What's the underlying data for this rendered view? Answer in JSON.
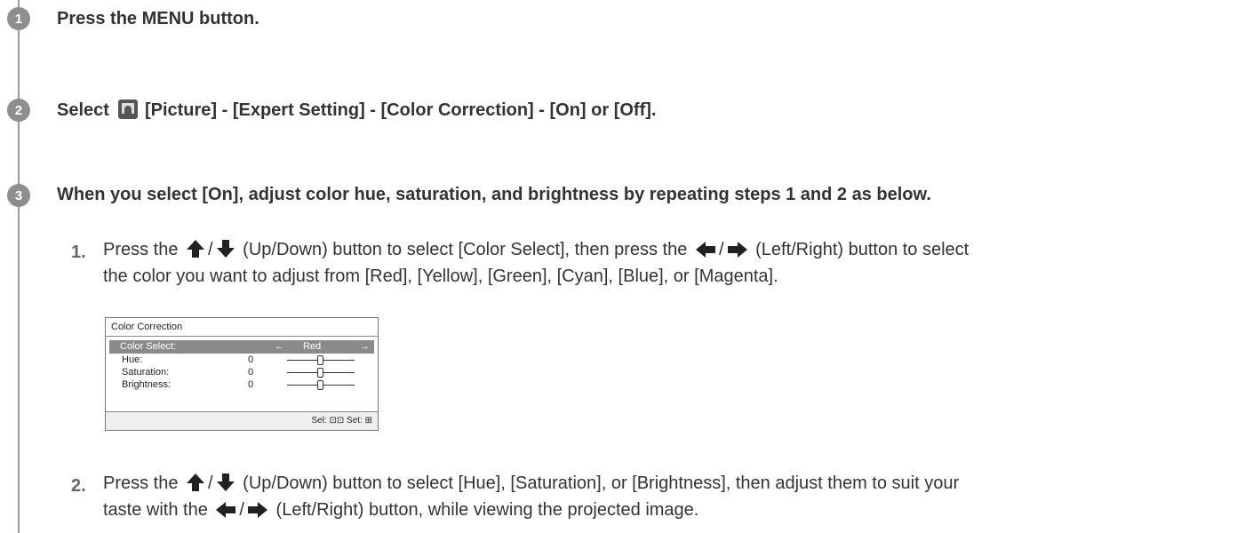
{
  "steps": [
    {
      "number": "1",
      "text": "Press the MENU button."
    },
    {
      "number": "2",
      "prefix": "Select",
      "text": "[Picture] - [Expert Setting] - [Color Correction] - [On] or [Off]."
    },
    {
      "number": "3",
      "text": "When you select [On], adjust color hue, saturation, and brightness by repeating steps 1 and 2 as below."
    }
  ],
  "substeps": [
    {
      "number": "1.",
      "line1_a": "Press the",
      "line1_b": "(Up/Down) button to select [Color Select], then press the",
      "line1_c": "(Left/Right) button to select",
      "line2": "the color you want to adjust from [Red], [Yellow], [Green], [Cyan], [Blue], or [Magenta]."
    },
    {
      "number": "2.",
      "line1_a": "Press the",
      "line1_b": "(Up/Down) button to select [Hue], [Saturation], or [Brightness], then adjust them to suit your",
      "line2_a": "taste with the",
      "line2_b": "(Left/Right) button, while viewing the projected image."
    }
  ],
  "slash": "/",
  "menu_panel": {
    "title": "Color Correction",
    "selected_label": "Color Select:",
    "selected_value": "Red",
    "rows": [
      {
        "label": "Hue:",
        "value": "0"
      },
      {
        "label": "Saturation:",
        "value": "0"
      },
      {
        "label": "Brightness:",
        "value": "0"
      }
    ],
    "footer": "Sel: ⊡⊡   Set: ⊞"
  },
  "icons": {
    "picture": "picture-icon",
    "up": "arrow-up-icon",
    "down": "arrow-down-icon",
    "left": "arrow-left-icon",
    "right": "arrow-right-icon"
  },
  "colors": {
    "step_badge": "#8e8e8e",
    "rail": "#9a9a9a",
    "selected_row": "#8a8a8a"
  }
}
